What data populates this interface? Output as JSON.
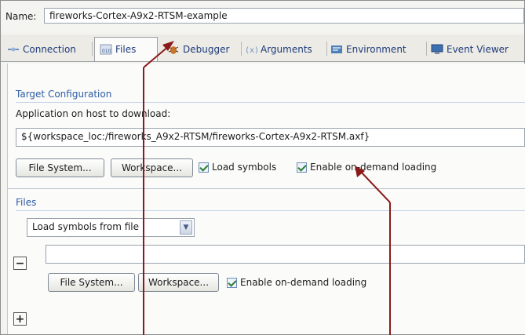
{
  "name_row": {
    "label": "Name:",
    "value": "fireworks-Cortex-A9x2-RTSM-example"
  },
  "tabs": [
    {
      "label": "Connection",
      "icon": "connection-icon"
    },
    {
      "label": "Files",
      "icon": "files-icon",
      "active": true
    },
    {
      "label": "Debugger",
      "icon": "debugger-icon"
    },
    {
      "label": "Arguments",
      "icon": "arguments-icon"
    },
    {
      "label": "Environment",
      "icon": "environment-icon"
    },
    {
      "label": "Event Viewer",
      "icon": "event-viewer-icon"
    }
  ],
  "target_config": {
    "title": "Target Configuration",
    "app_label": "Application on host to download:",
    "app_path": "${workspace_loc:/fireworks_A9x2-RTSM/fireworks-Cortex-A9x2-RTSM.axf}",
    "file_system_btn": "File System...",
    "workspace_btn": "Workspace...",
    "load_symbols": "Load symbols",
    "enable_on_demand": "Enable on-demand loading"
  },
  "files": {
    "title": "Files",
    "select_value": "Load symbols from file",
    "remove_btn": "−",
    "path_value": "",
    "file_system_btn": "File System...",
    "workspace_btn": "Workspace...",
    "enable_on_demand": "Enable on-demand loading",
    "add_btn": "+"
  },
  "colors": {
    "accent": "#2d5ca6",
    "arrow": "#8b1a1a"
  }
}
